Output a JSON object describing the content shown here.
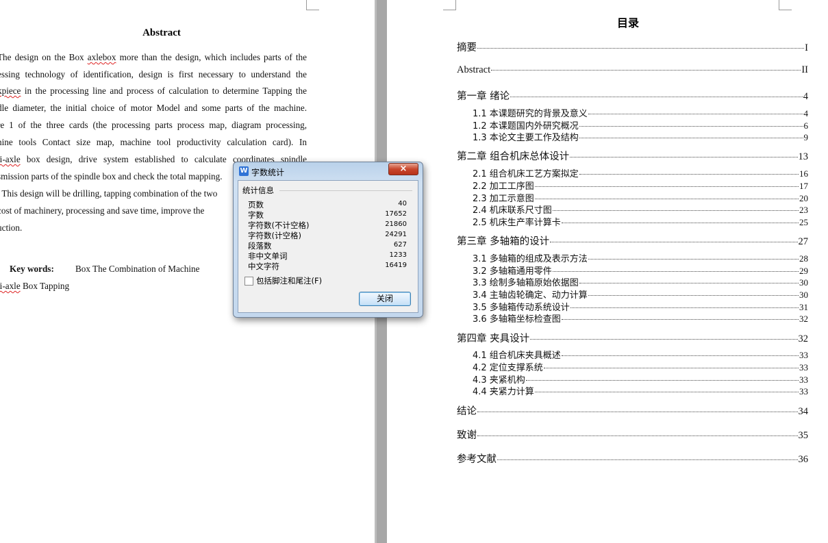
{
  "abstract": {
    "title": "Abstract",
    "lines": [
      "The design on the   Box axlebox more than the design, which includes parts of the",
      "essing technology of identification, design is first necessary to understand the",
      "kpiece in the processing line and process of calculation to determine Tapping the",
      "dle diameter, the initial choice of motor Model and some parts of the machine.",
      "re 1 of the three cards (the processing parts process map, diagram processing,",
      "hine tools Contact size map, machine tool productivity calculation card). In",
      "ti-axle box design, drive system established to calculate coordinates spindle",
      "smission parts of the spindle box and check the total mapping.",
      ". This design will be drilling, tapping combination of the two",
      "cost of machinery, processing and save time, improve the",
      "uction."
    ],
    "keywords_label": "Key words:",
    "keywords_line1": "Box    The Combination of Machine",
    "keywords_line2": "ti-axle Box Tapping"
  },
  "toc": {
    "title": "目录",
    "entries": [
      {
        "text": "摘要",
        "page": "I",
        "level": 1
      },
      {
        "text": "Abstract",
        "page": "II",
        "level": 1
      },
      {
        "text": "第一章  绪论",
        "page": "4",
        "level": 1
      },
      {
        "text": "1.1 本课题研究的背景及意义",
        "page": "4",
        "level": 2
      },
      {
        "text": "1.2 本课题国内外研究概况",
        "page": "6",
        "level": 2
      },
      {
        "text": "1.3 本论文主要工作及结构",
        "page": "9",
        "level": 2
      },
      {
        "text": "第二章  组合机床总体设计",
        "page": "13",
        "level": 1
      },
      {
        "text": "2.1 组合机床工艺方案拟定",
        "page": "16",
        "level": 2
      },
      {
        "text": "2.2 加工工序图",
        "page": "17",
        "level": 2
      },
      {
        "text": "2.3 加工示意图",
        "page": "20",
        "level": 2
      },
      {
        "text": "2.4 机床联系尺寸图",
        "page": "23",
        "level": 2
      },
      {
        "text": "2.5 机床生产率计算卡",
        "page": "25",
        "level": 2
      },
      {
        "text": "第三章  多轴箱的设计",
        "page": "27",
        "level": 1
      },
      {
        "text": "3.1 多轴箱的组成及表示方法",
        "page": "28",
        "level": 2
      },
      {
        "text": "3.2 多轴箱通用零件",
        "page": "29",
        "level": 2
      },
      {
        "text": "3.3 绘制多轴箱原始依据图",
        "page": "30",
        "level": 2
      },
      {
        "text": "3.4 主轴齿轮确定、动力计算",
        "page": "30",
        "level": 2
      },
      {
        "text": "3.5 多轴箱传动系统设计",
        "page": "31",
        "level": 2
      },
      {
        "text": "3.6 多轴箱坐标检查图",
        "page": "32",
        "level": 2
      },
      {
        "text": "第四章  夹具设计",
        "page": "32",
        "level": 1
      },
      {
        "text": "4.1 组合机床夹具概述",
        "page": "33",
        "level": 2
      },
      {
        "text": "4.2 定位支撑系统",
        "page": "33",
        "level": 2
      },
      {
        "text": "4.3 夹紧机构",
        "page": "33",
        "level": 2
      },
      {
        "text": "4.4 夹紧力计算",
        "page": "33",
        "level": 2
      },
      {
        "text": "结论",
        "page": "34",
        "level": 1
      },
      {
        "text": "致谢",
        "page": "35",
        "level": 1
      },
      {
        "text": "参考文献",
        "page": "36",
        "level": 1
      }
    ]
  },
  "dialog": {
    "title": "字数统计",
    "app_icon": "W",
    "close_glyph": "×",
    "group_label": "统计信息",
    "stats": [
      {
        "label": "页数",
        "value": "40"
      },
      {
        "label": "字数",
        "value": "17652"
      },
      {
        "label": "字符数(不计空格)",
        "value": "21860"
      },
      {
        "label": "字符数(计空格)",
        "value": "24291"
      },
      {
        "label": "段落数",
        "value": "627"
      },
      {
        "label": "非中文单词",
        "value": "1233"
      },
      {
        "label": "中文字符",
        "value": "16419"
      }
    ],
    "checkbox_label": "包括脚注和尾注(F)",
    "checkbox_checked": false,
    "close_button": "关闭"
  }
}
